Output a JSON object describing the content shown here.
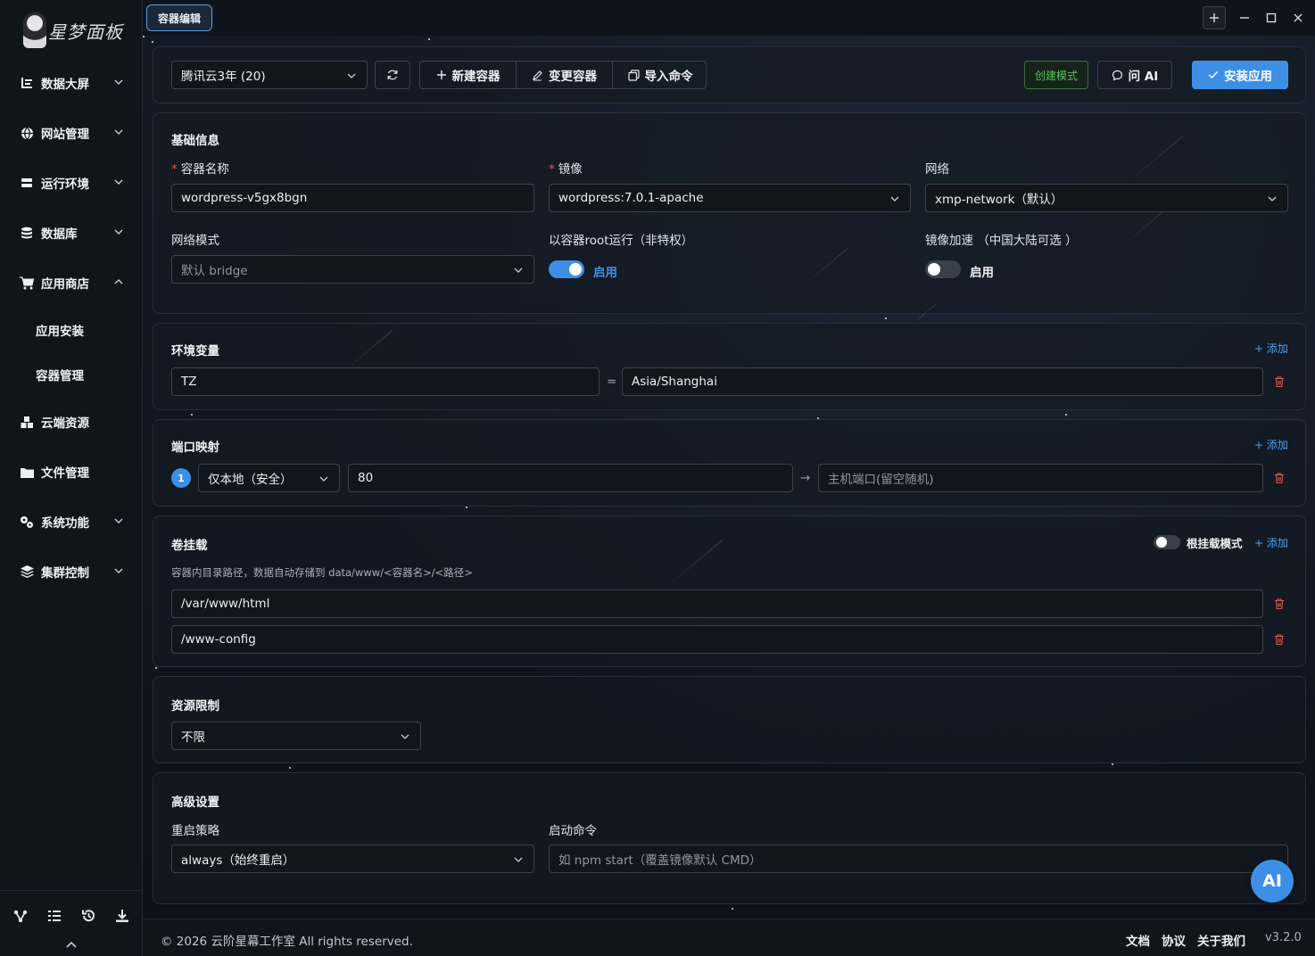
{
  "app": {
    "logo_text": "星梦面板",
    "tab_title": "容器编辑"
  },
  "sidebar": {
    "items": [
      {
        "label": "数据大屏"
      },
      {
        "label": "网站管理"
      },
      {
        "label": "运行环境"
      },
      {
        "label": "数据库"
      },
      {
        "label": "应用商店"
      },
      {
        "label": "云端资源"
      },
      {
        "label": "文件管理"
      },
      {
        "label": "系统功能"
      },
      {
        "label": "集群控制"
      }
    ],
    "sub_items": [
      {
        "label": "应用安装"
      },
      {
        "label": "容器管理"
      }
    ]
  },
  "toolbar": {
    "server_select": "腾讯云3年 (20)",
    "new_container": "新建容器",
    "change_container": "变更容器",
    "import_command": "导入命令",
    "create_mode": "创建模式",
    "ask_ai": "问 AI",
    "install_app": "安装应用"
  },
  "basic": {
    "title": "基础信息",
    "container_name_label": "容器名称",
    "container_name_value": "wordpress-v5gx8bgn",
    "image_label": "镜像",
    "image_value": "wordpress:7.0.1-apache",
    "network_label": "网络",
    "network_value": "xmp-network（默认）",
    "network_mode_label": "网络模式",
    "network_mode_value": "默认 bridge",
    "root_label": "以容器root运行（非特权）",
    "root_switch_text": "启用",
    "root_enabled": true,
    "mirror_label": "镜像加速 （中国大陆可选 ）",
    "mirror_switch_text": "启用",
    "mirror_enabled": false
  },
  "env": {
    "title": "环境变量",
    "add": "+ 添加",
    "key": "TZ",
    "equals": "=",
    "value": "Asia/Shanghai"
  },
  "ports": {
    "title": "端口映射",
    "add": "+ 添加",
    "index": "1",
    "bind_select": "仅本地（安全）",
    "container_port": "80",
    "arrow": "→",
    "host_port_placeholder": "主机端口(留空随机)"
  },
  "volumes": {
    "title": "卷挂载",
    "root_mount_label": "根挂载模式",
    "root_mount_enabled": false,
    "add": "+ 添加",
    "hint": "容器内目录路径，数据自动存储到 data/www/<容器名>/<路径>",
    "paths": [
      "/var/www/html",
      "/www-config"
    ]
  },
  "resources": {
    "title": "资源限制",
    "value": "不限"
  },
  "advanced": {
    "title": "高级设置",
    "restart_label": "重启策略",
    "restart_value": "always（始终重启）",
    "command_label": "启动命令",
    "command_placeholder": "如 npm start（覆盖镜像默认 CMD）"
  },
  "footer": {
    "copyright": "© 2026 云阶星幕工作室 All rights reserved.",
    "docs": "文档",
    "agreement": "协议",
    "about": "关于我们",
    "version": "v3.2.0"
  },
  "ai_button": "AI",
  "colors": {
    "accent": "#3d8fe6",
    "danger": "#e25555",
    "success": "#5ac15a",
    "bg": "#0f141c"
  }
}
